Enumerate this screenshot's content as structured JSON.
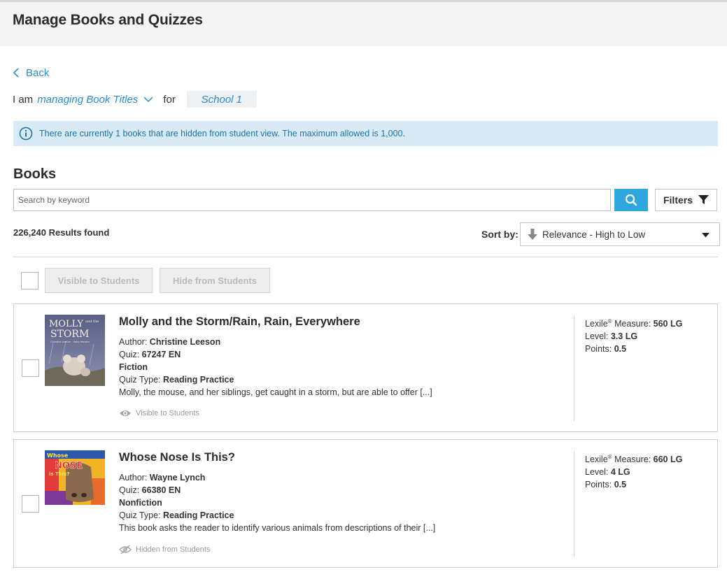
{
  "header": {
    "title": "Manage Books and Quizzes"
  },
  "nav": {
    "back_label": "Back"
  },
  "context": {
    "prefix": "I am",
    "mode": "managing Book Titles",
    "for_label": "for",
    "school": "School 1"
  },
  "info_banner": {
    "text": "There are currently 1 books that are hidden from student view. The maximum allowed is 1,000."
  },
  "books": {
    "heading": "Books",
    "search_placeholder": "Search by keyword",
    "filters_label": "Filters",
    "results_text": "226,240 Results found",
    "sort_label": "Sort by:",
    "sort_value": "Relevance - High to Low",
    "bulk": {
      "visible_label": "Visible to Students",
      "hide_label": "Hide from Students"
    },
    "items": [
      {
        "title": "Molly and the Storm/Rain, Rain, Everywhere",
        "author_label": "Author:",
        "author": "Christine Leeson",
        "quiz_label": "Quiz:",
        "quiz": "67247 EN",
        "genre": "Fiction",
        "quiz_type_label": "Quiz Type:",
        "quiz_type": "Reading Practice",
        "description": "Molly, the mouse, and her siblings, get caught in a storm, but are able to offer [...]",
        "visibility": "Visible to Students",
        "lexile_label": "Lexile",
        "lexile_suffix": "Measure:",
        "lexile": "560 LG",
        "level_label": "Level:",
        "level": "3.3 LG",
        "points_label": "Points:",
        "points": "0.5",
        "cover_title_1": "MOLLY",
        "cover_title_2": "STORM",
        "cover_small": "and the",
        "cover_authors": "Christine Leeson · Gaby Hansen"
      },
      {
        "title": "Whose Nose Is This?",
        "author_label": "Author:",
        "author": "Wayne Lynch",
        "quiz_label": "Quiz:",
        "quiz": "66380 EN",
        "genre": "Nonfiction",
        "quiz_type_label": "Quiz Type:",
        "quiz_type": "Reading Practice",
        "description": "This book asks the reader to identify various animals from descriptions of their [...]",
        "visibility": "Hidden from Students",
        "lexile_label": "Lexile",
        "lexile_suffix": "Measure:",
        "lexile": "660 LG",
        "level_label": "Level:",
        "level": "4 LG",
        "points_label": "Points:",
        "points": "0.5",
        "cover_word_1": "Whose",
        "cover_word_2": "NOSE",
        "cover_word_3": "is This?"
      }
    ]
  },
  "colors": {
    "accent": "#2a8ccf",
    "search_button": "#2ea6e0",
    "info_bg": "#d8eaf5"
  },
  "icons": {
    "back": "chevron-left-icon",
    "mode_dropdown": "chevron-down-icon",
    "info": "info-circle-icon",
    "search": "search-icon",
    "filters": "filter-funnel-icon",
    "sort_direction": "arrow-down-icon",
    "sort_caret": "caret-down-icon",
    "visible": "eye-icon",
    "hidden": "eye-slash-icon"
  }
}
